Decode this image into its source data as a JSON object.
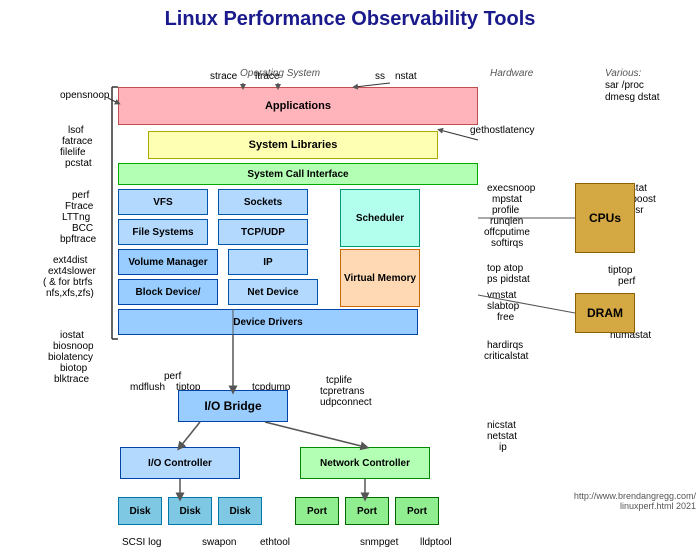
{
  "title": "Linux Performance Observability Tools",
  "section_labels": {
    "os": "Operating System",
    "hardware": "Hardware",
    "various": "Various:"
  },
  "boxes": {
    "applications": "Applications",
    "system_libraries": "System Libraries",
    "syscall_interface": "System Call Interface",
    "vfs": "VFS",
    "sockets": "Sockets",
    "scheduler": "Scheduler",
    "filesystems": "File Systems",
    "tcp_udp": "TCP/UDP",
    "volume_manager": "Volume Manager",
    "ip": "IP",
    "virtual_memory": "Virtual Memory",
    "block_device": "Block Device/",
    "net_device": "Net Device",
    "device_drivers": "Device Drivers",
    "io_bridge": "I/O Bridge",
    "io_controller": "I/O Controller",
    "net_controller": "Network Controller",
    "disk1": "Disk",
    "disk2": "Disk",
    "disk3": "Disk",
    "port1": "Port",
    "port2": "Port",
    "port3": "Port",
    "cpus": "CPUs",
    "dram": "DRAM"
  },
  "left_labels": {
    "strace": "strace",
    "ltrace": "ltrace",
    "opensnoop": "opensnoop",
    "lsof": "lsof",
    "fatrace": "fatrace",
    "filelife": "filelife",
    "pcstat": "pcstat",
    "perf": "perf",
    "ftrace": "Ftrace",
    "ltng": "LTTng",
    "bcc": "BCC",
    "bpftrace": "bpftrace",
    "ext4dist": "ext4dist",
    "ext4slower": "ext4slower",
    "btrfs_note": "( & for btrfs",
    "nfs_xfs_zfs": "nfs,xfs,zfs)",
    "iostat": "iostat",
    "biosnoop": "biosnoop",
    "biolatency": "biolatency",
    "biotop": "biotop",
    "blktrace": "blktrace",
    "ss": "ss",
    "nstat": "nstat"
  },
  "right_labels": {
    "gethostlatency": "gethostlatency",
    "execsnoop": "execsnoop",
    "mpstat": "mpstat",
    "profile": "profile",
    "runqlen": "runqlen",
    "offcputime": "offcputime",
    "softirqs": "softirqs",
    "top_atop": "top atop",
    "ps_pidstat": "ps pidstat",
    "vmstat": "vmstat",
    "slabtop": "slabtop",
    "free": "free",
    "hardirqs": "hardirqs",
    "criticalstat": "criticalstat",
    "nicstat": "nicstat",
    "netstat": "netstat",
    "ip": "ip",
    "numastat": "numastat",
    "turbostat": "turbostat",
    "showboost": "showboost",
    "rdmsr": "rdmsr",
    "tiptop": "tiptop",
    "perf_hw": "perf",
    "sar_proc": "sar /proc",
    "dmesg_dstat": "dmesg dstat",
    "various": "Various:"
  },
  "bottom_labels": {
    "scsi_log": "SCSI log",
    "swapon": "swapon",
    "ethtool": "ethtool",
    "snmpget": "snmpget",
    "lldptool": "lldptool",
    "mdflush": "mdflush",
    "tiptop": "tiptop",
    "tcpdump": "tcpdump",
    "tcplife": "tcplife",
    "tcpretrans": "tcpretrans",
    "udpconnect": "udpconnect",
    "perf_io": "perf"
  },
  "footnote": "http://www.brendangregg.com/\nlinuxperf.html 2021"
}
